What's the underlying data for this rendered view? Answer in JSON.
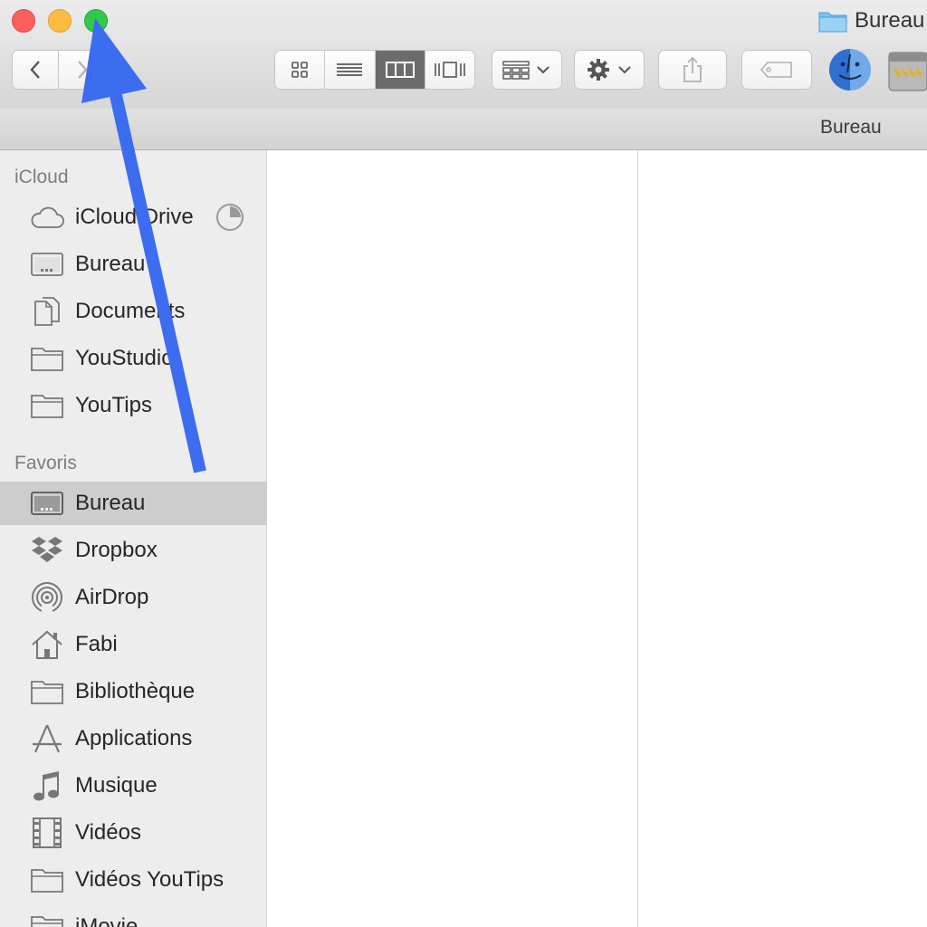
{
  "window": {
    "title": "Bureau"
  },
  "toolbar": {
    "back_icon": "chevron-left-icon",
    "forward_icon": "chevron-right-icon",
    "view_modes": [
      "icon-view",
      "list-view",
      "column-view",
      "cover-flow-view"
    ],
    "active_view": "column-view",
    "arrange_icon": "grid-arrange-icon",
    "action_icon": "gear-icon",
    "share_icon": "share-icon",
    "tag_icon": "tag-icon",
    "extra_icons": [
      "finder-icon",
      "trash-icon"
    ]
  },
  "pathbar": {
    "label": "Bureau"
  },
  "sidebar": {
    "icloud": {
      "header": "iCloud",
      "items": [
        {
          "label": "iCloud Drive",
          "icon": "cloud-icon"
        },
        {
          "label": "Bureau",
          "icon": "desktop-icon"
        },
        {
          "label": "Documents",
          "icon": "documents-icon"
        },
        {
          "label": "YouStudio",
          "icon": "folder-icon"
        },
        {
          "label": "YouTips",
          "icon": "folder-icon"
        }
      ]
    },
    "favoris": {
      "header": "Favoris",
      "items": [
        {
          "label": "Bureau",
          "icon": "desktop-icon",
          "selected": true
        },
        {
          "label": "Dropbox",
          "icon": "dropbox-icon"
        },
        {
          "label": "AirDrop",
          "icon": "airdrop-icon"
        },
        {
          "label": "Fabi",
          "icon": "home-icon"
        },
        {
          "label": "Bibliothèque",
          "icon": "folder-icon"
        },
        {
          "label": "Applications",
          "icon": "applications-icon"
        },
        {
          "label": "Musique",
          "icon": "music-icon"
        },
        {
          "label": "Vidéos",
          "icon": "film-icon"
        },
        {
          "label": "Vidéos YouTips",
          "icon": "folder-icon"
        },
        {
          "label": "iMovie",
          "icon": "folder-icon"
        }
      ]
    }
  },
  "colors": {
    "close": "#fc605c",
    "minimize": "#fdbc40",
    "zoom": "#34c84a",
    "annotation_arrow": "#3c6cf0",
    "sidebar_bg": "#ededed",
    "selection_bg": "#cdcdcd"
  }
}
